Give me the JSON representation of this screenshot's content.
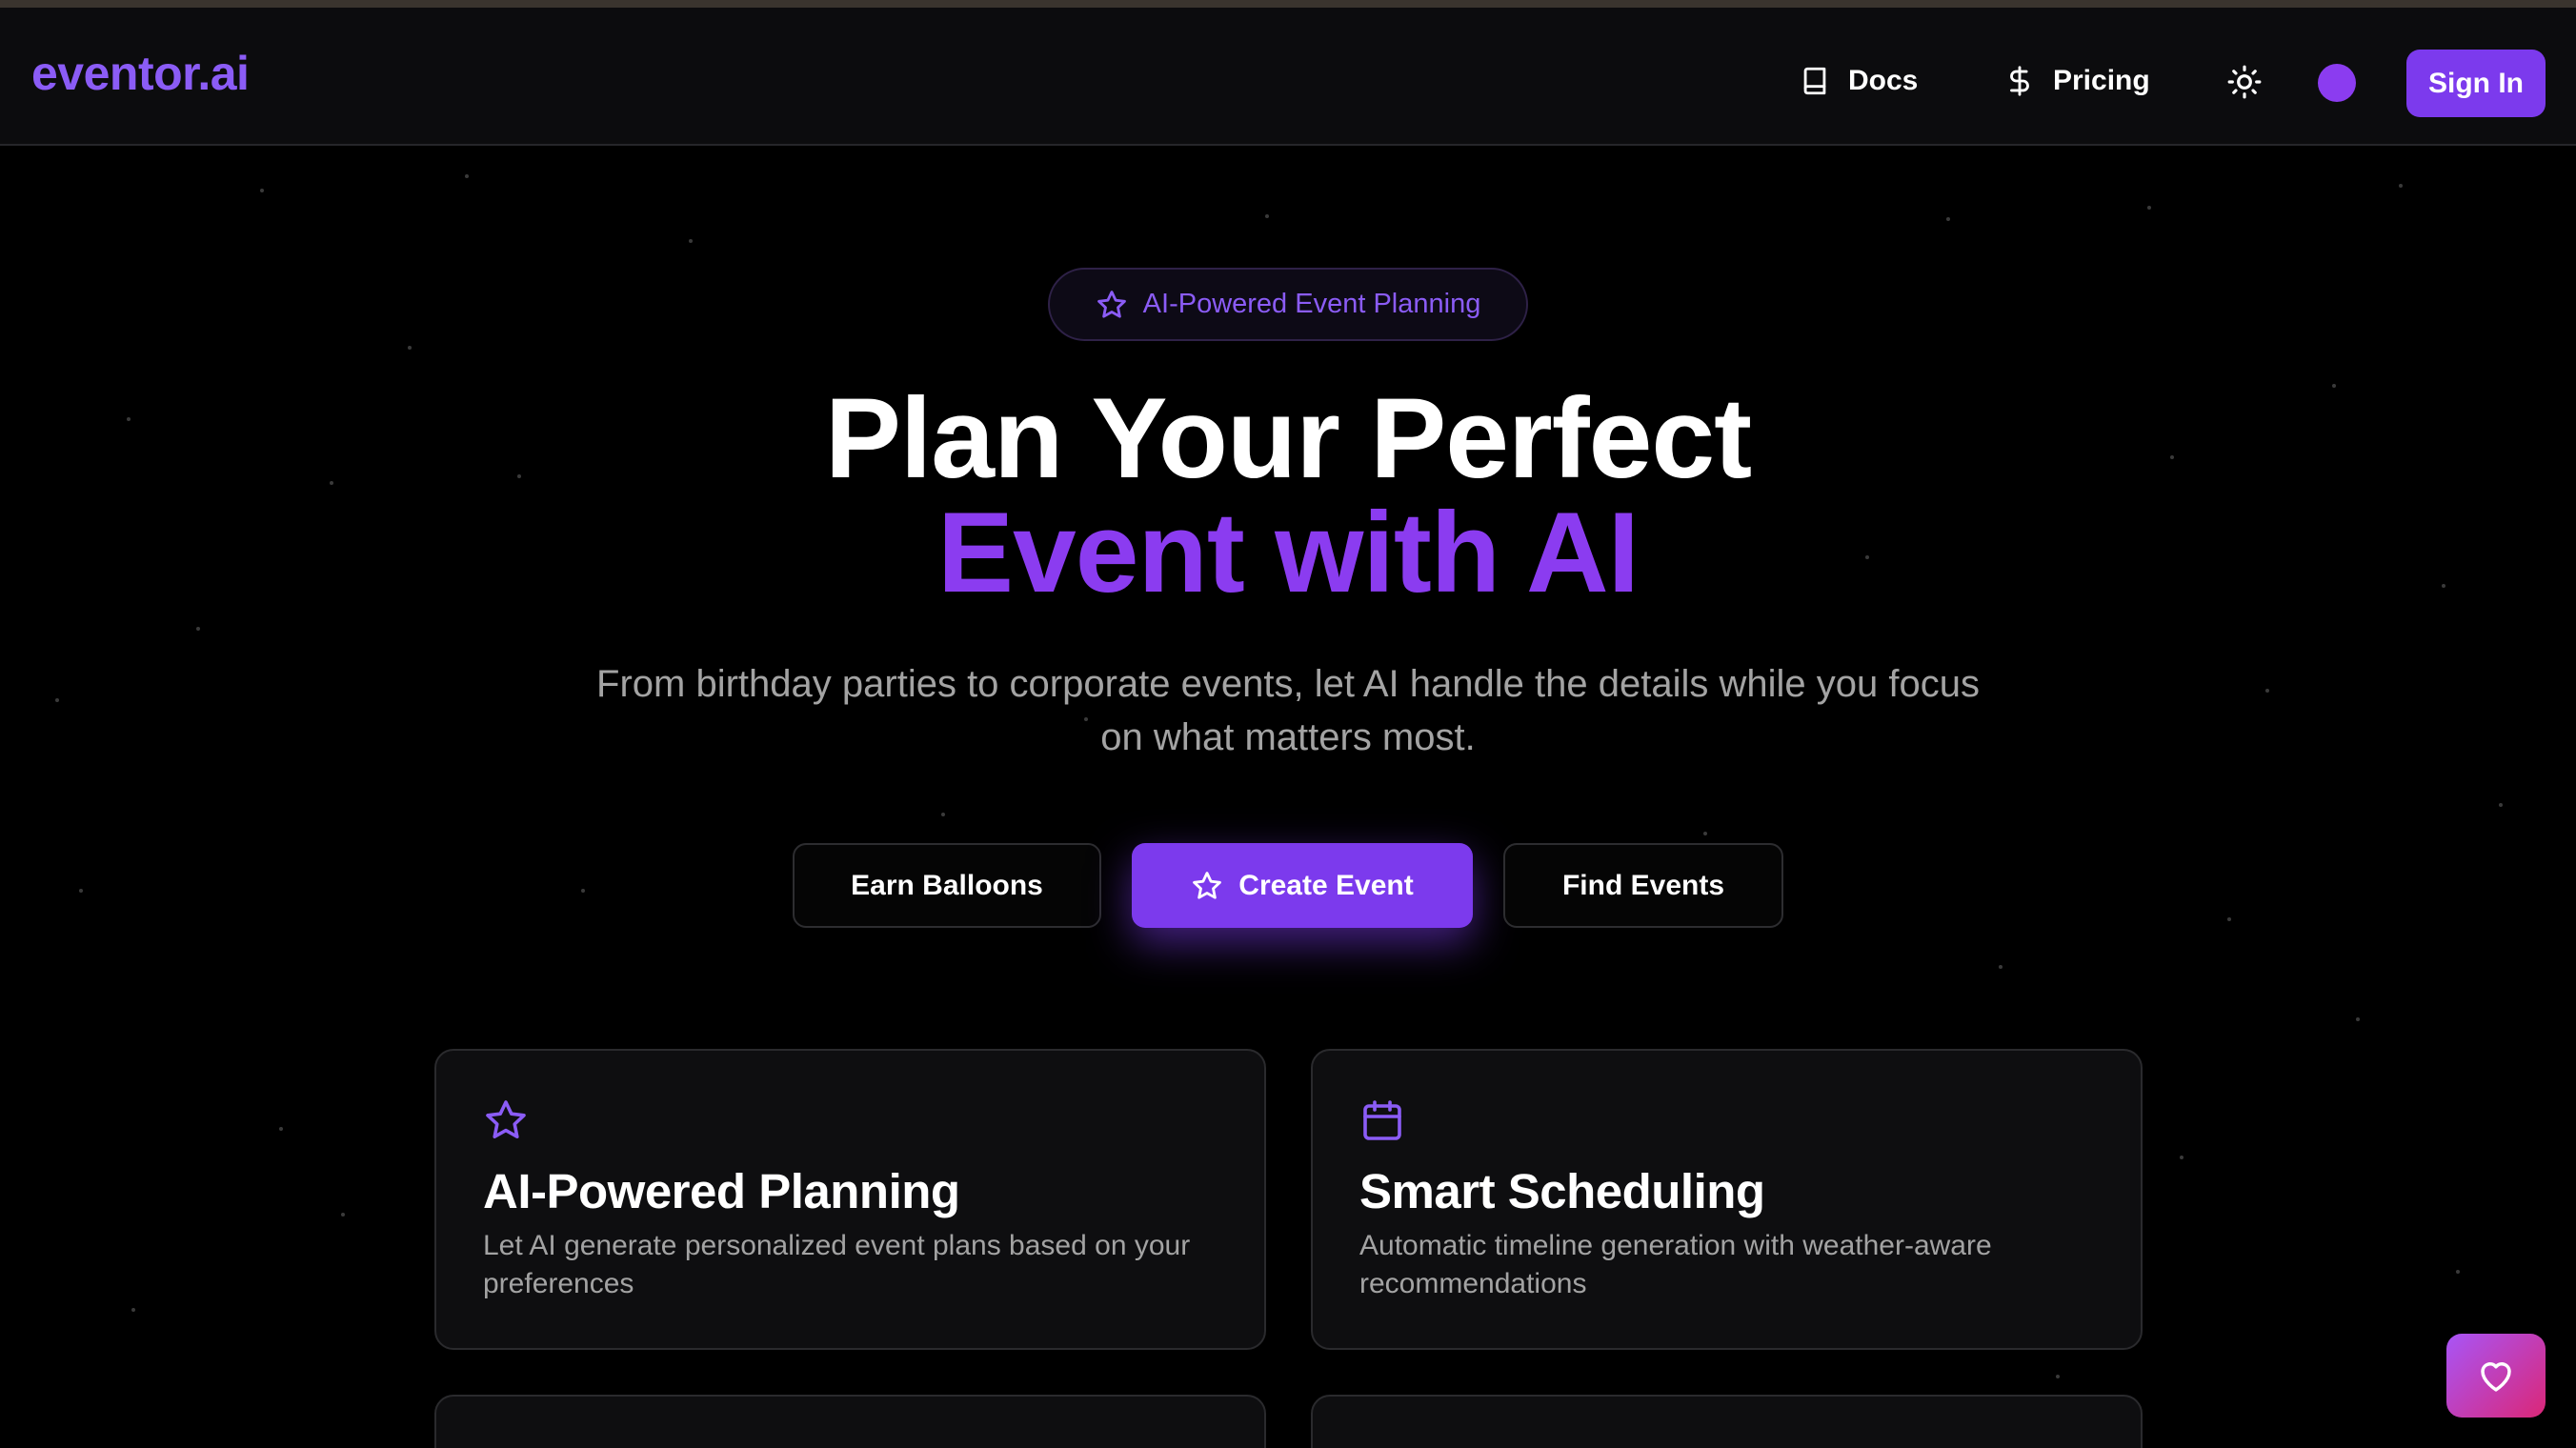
{
  "brand": {
    "logo": "eventor.ai",
    "accent": "#7c3aed"
  },
  "nav": {
    "links": [
      {
        "label": "Docs",
        "icon": "book-icon"
      },
      {
        "label": "Pricing",
        "icon": "dollar-icon"
      }
    ],
    "theme_toggle_icon": "sun-icon",
    "sign_in": "Sign In"
  },
  "hero": {
    "badge": "AI-Powered Event Planning",
    "title_line1": "Plan Your Perfect",
    "title_line2": "Event with AI",
    "subtitle": "From birthday parties to corporate events, let AI handle the details while you focus on what matters most.",
    "buttons": {
      "earn": "Earn Balloons",
      "create": "Create Event",
      "find": "Find Events"
    }
  },
  "features": [
    {
      "icon": "star-icon",
      "title": "AI-Powered Planning",
      "description": "Let AI generate personalized event plans based on your preferences"
    },
    {
      "icon": "calendar-icon",
      "title": "Smart Scheduling",
      "description": "Automatic timeline generation with weather-aware recommendations"
    }
  ],
  "fab": {
    "icon": "heart-icon"
  }
}
